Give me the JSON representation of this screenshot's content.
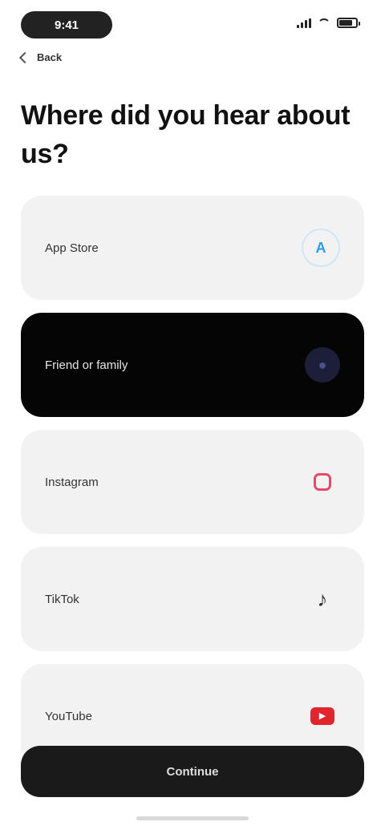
{
  "status_bar": {
    "time": "9:41"
  },
  "nav": {
    "back_label": "Back"
  },
  "header": {
    "title": "Where did you hear about us?"
  },
  "options": [
    {
      "label": "App Store",
      "icon": "app-store-icon",
      "glyph": "A",
      "color": "#2b9bf4",
      "selected": false
    },
    {
      "label": "Friend or family",
      "icon": "people-icon",
      "glyph": "●",
      "color": "#3a3f7a",
      "selected": true
    },
    {
      "label": "Instagram",
      "icon": "instagram-icon",
      "glyph": "◻",
      "color": "#e64a6b",
      "selected": false
    },
    {
      "label": "TikTok",
      "icon": "tiktok-icon",
      "glyph": "♪",
      "color": "#333333",
      "selected": false
    },
    {
      "label": "YouTube",
      "icon": "youtube-icon",
      "glyph": "▶",
      "color": "#e0252d",
      "selected": false
    }
  ],
  "footer": {
    "continue_label": "Continue"
  }
}
